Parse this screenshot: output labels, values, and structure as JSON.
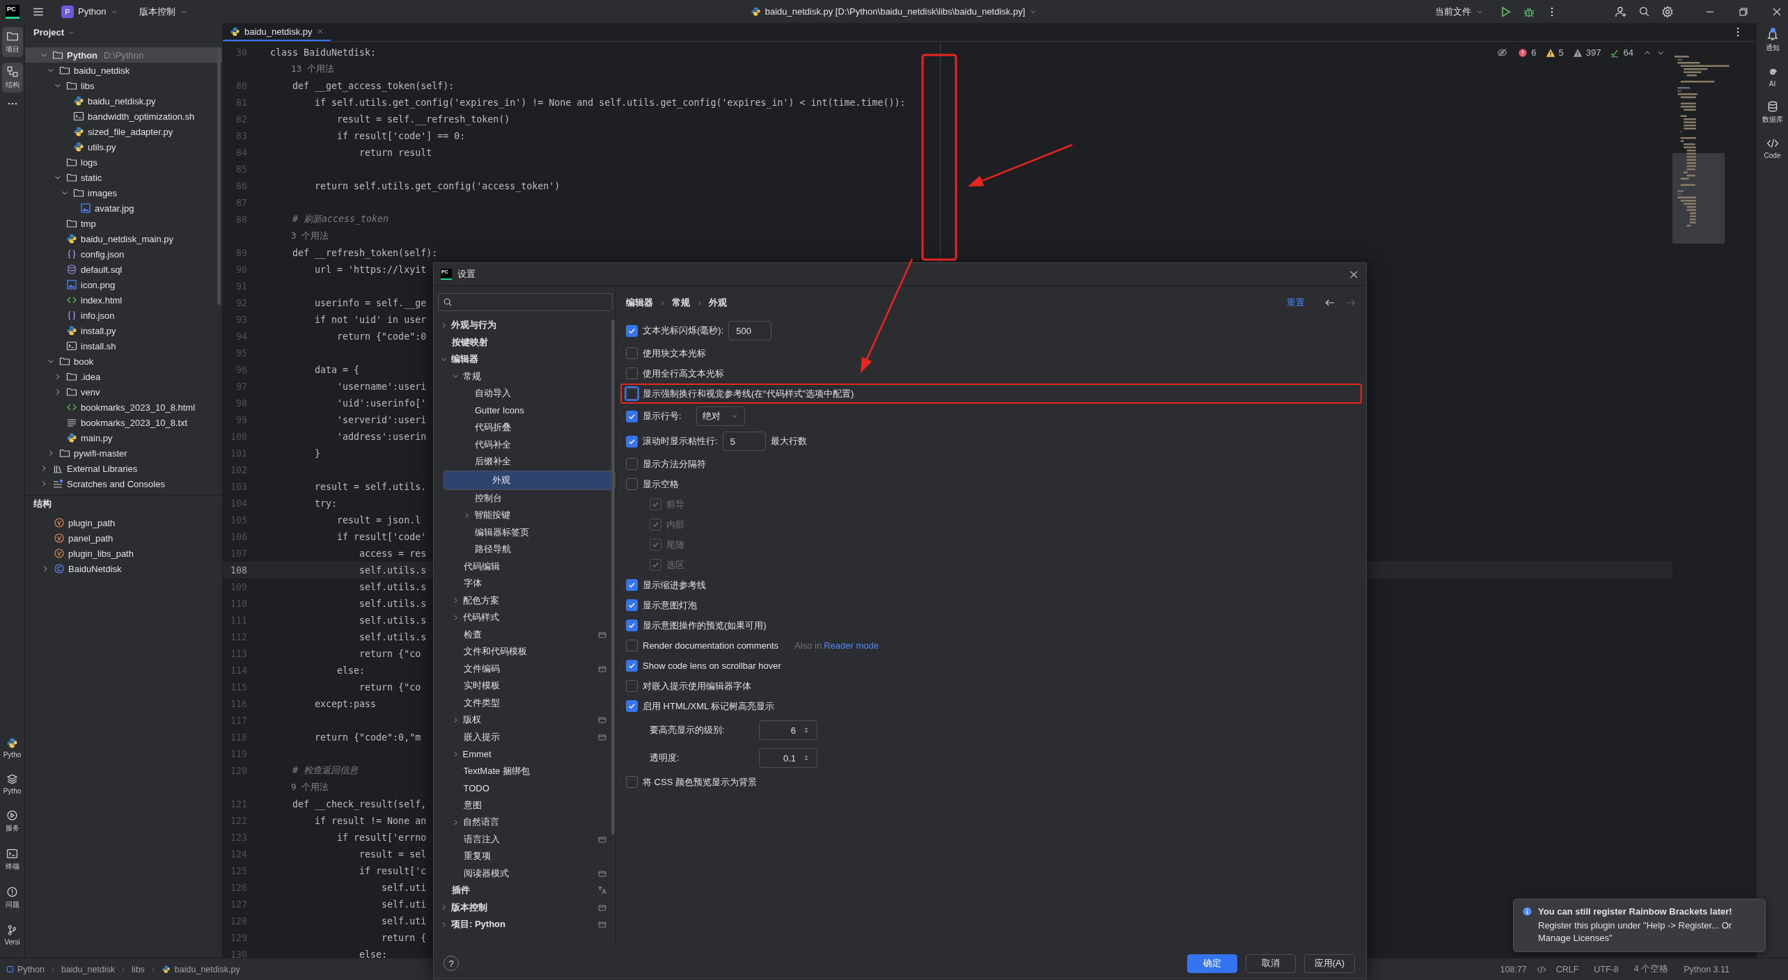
{
  "top_bar": {
    "logo": "PC",
    "project_badge": "P",
    "project": "Python",
    "vcs": "版本控制",
    "file_title": "baidu_netdisk.py [D:\\Python\\baidu_netdisk\\libs\\baidu_netdisk.py]",
    "run_config": "当前文件"
  },
  "left_toolbar": {
    "top": [
      {
        "kind": "folder",
        "label": "项目",
        "selected": true
      },
      {
        "kind": "structure",
        "label": "结构",
        "selected": true
      }
    ],
    "bottom": [
      {
        "kind": "python",
        "label": "Pytho"
      },
      {
        "kind": "layers",
        "label": "Pytho"
      },
      {
        "kind": "services",
        "label": "服务"
      },
      {
        "kind": "terminal",
        "label": "终端"
      },
      {
        "kind": "problems",
        "label": "问题"
      },
      {
        "kind": "git",
        "label": "Versi"
      }
    ]
  },
  "right_toolbar": [
    {
      "kind": "bell",
      "label": "通知",
      "badge": true
    },
    {
      "kind": "spiral",
      "label": "AI",
      "badge": false
    },
    {
      "kind": "database",
      "label": "数据库",
      "badge": false
    },
    {
      "kind": "code",
      "label": "Code",
      "badge": false
    }
  ],
  "project_panel": {
    "title": "Project",
    "tree": [
      {
        "name": "Python",
        "note": "D:\\Python",
        "kind": "folder",
        "expanded": true,
        "selected": true,
        "children": [
          {
            "name": "baidu_netdisk",
            "kind": "folder",
            "expanded": true,
            "selected": false,
            "children": [
              {
                "name": "libs",
                "kind": "folder",
                "expanded": true,
                "selected": false,
                "children": [
                  {
                    "name": "baidu_netdisk.py",
                    "kind": "python",
                    "selected": false
                  },
                  {
                    "name": "bandwidth_optimization.sh",
                    "kind": "shell",
                    "selected": false
                  },
                  {
                    "name": "sized_file_adapter.py",
                    "kind": "python",
                    "selected": false
                  },
                  {
                    "name": "utils.py",
                    "kind": "python",
                    "selected": false
                  }
                ]
              },
              {
                "name": "logs",
                "kind": "folder",
                "selected": false
              },
              {
                "name": "static",
                "kind": "folder",
                "expanded": true,
                "selected": false,
                "children": [
                  {
                    "name": "images",
                    "kind": "folder",
                    "expanded": true,
                    "selected": false,
                    "children": [
                      {
                        "name": "avatar.jpg",
                        "kind": "image",
                        "selected": false
                      }
                    ]
                  }
                ]
              },
              {
                "name": "tmp",
                "kind": "folder",
                "selected": false
              },
              {
                "name": "baidu_netdisk_main.py",
                "kind": "python",
                "selected": false
              },
              {
                "name": "config.json",
                "kind": "json",
                "selected": false
              },
              {
                "name": "default.sql",
                "kind": "sql",
                "selected": false
              },
              {
                "name": "icon.png",
                "kind": "image",
                "selected": false
              },
              {
                "name": "index.html",
                "kind": "html",
                "selected": false
              },
              {
                "name": "info.json",
                "kind": "json",
                "selected": false
              },
              {
                "name": "install.py",
                "kind": "python",
                "selected": false
              },
              {
                "name": "install.sh",
                "kind": "shell",
                "selected": false
              }
            ]
          },
          {
            "name": "book",
            "kind": "folder",
            "expanded": true,
            "selected": false,
            "children": [
              {
                "name": ".idea",
                "kind": "folder",
                "expanded": false,
                "selected": false
              },
              {
                "name": "venv",
                "kind": "folder",
                "expanded": false,
                "selected": false
              },
              {
                "name": "bookmarks_2023_10_8.html",
                "kind": "html",
                "selected": false
              },
              {
                "name": "bookmarks_2023_10_8.txt",
                "kind": "text",
                "selected": false
              },
              {
                "name": "main.py",
                "kind": "python",
                "selected": false
              }
            ]
          },
          {
            "name": "pywifi-master",
            "kind": "folder",
            "expanded": false,
            "selected": false
          }
        ]
      },
      {
        "name": "External Libraries",
        "kind": "library",
        "expanded": false,
        "selected": false
      },
      {
        "name": "Scratches and Consoles",
        "kind": "scratch",
        "expanded": false,
        "selected": false
      }
    ]
  },
  "structure_panel": {
    "title": "结构",
    "items": [
      {
        "name": "plugin_path",
        "kind": "variable"
      },
      {
        "name": "panel_path",
        "kind": "variable"
      },
      {
        "name": "plugin_libs_path",
        "kind": "variable"
      },
      {
        "name": "BaiduNetdisk",
        "kind": "class",
        "expanded": false
      }
    ]
  },
  "editor": {
    "tab": {
      "label": "baidu_netdisk.py",
      "selected": true
    },
    "inspections": {
      "errors": "6",
      "warnings": "5",
      "weak_warnings": "397",
      "typos": "64"
    },
    "right_margin_guide": true,
    "lines": [
      {
        "number": "30",
        "text": "class BaiduNetdisk:",
        "kind": "code",
        "current": false
      },
      {
        "text": "    13 个用法",
        "kind": "usages",
        "current": false
      },
      {
        "number": "80",
        "text": "    def __get_access_token(self):",
        "kind": "code",
        "current": false
      },
      {
        "number": "81",
        "text": "        if self.utils.get_config('expires_in') != None and self.utils.get_config('expires_in') < int(time.time()):",
        "kind": "code",
        "current": false
      },
      {
        "number": "82",
        "text": "            result = self.__refresh_token()",
        "kind": "code",
        "current": false
      },
      {
        "number": "83",
        "text": "            if result['code'] == 0:",
        "kind": "code",
        "current": false
      },
      {
        "number": "84",
        "text": "                return result",
        "kind": "code",
        "current": false
      },
      {
        "number": "85",
        "current": false
      },
      {
        "number": "86",
        "text": "        return self.utils.get_config('access_token')",
        "kind": "code",
        "current": false
      },
      {
        "number": "87",
        "current": false
      },
      {
        "number": "88",
        "text": "    # 刷新access_token",
        "kind": "comment",
        "current": false
      },
      {
        "text": "    3 个用法",
        "kind": "usages",
        "current": false
      },
      {
        "number": "89",
        "text": "    def __refresh_token(self):",
        "kind": "code",
        "current": false
      },
      {
        "number": "90",
        "text": "        url = 'https://lxyit",
        "kind": "code",
        "current": false
      },
      {
        "number": "91",
        "current": false
      },
      {
        "number": "92",
        "text": "        userinfo = self.__ge",
        "kind": "code",
        "current": false
      },
      {
        "number": "93",
        "text": "        if not 'uid' in user",
        "kind": "code",
        "current": false
      },
      {
        "number": "94",
        "text": "            return {\"code\":0",
        "kind": "code",
        "current": false
      },
      {
        "number": "95",
        "current": false
      },
      {
        "number": "96",
        "text": "        data = {",
        "kind": "code",
        "current": false
      },
      {
        "number": "97",
        "text": "            'username':useri",
        "kind": "code",
        "current": false
      },
      {
        "number": "98",
        "text": "            'uid':userinfo['",
        "kind": "code",
        "current": false
      },
      {
        "number": "99",
        "text": "            'serverid':useri",
        "kind": "code",
        "current": false
      },
      {
        "number": "100",
        "text": "            'address':userin",
        "kind": "code",
        "current": false
      },
      {
        "number": "101",
        "text": "        }",
        "kind": "code",
        "current": false
      },
      {
        "number": "102",
        "current": false
      },
      {
        "number": "103",
        "text": "        result = self.utils.",
        "kind": "code",
        "current": false
      },
      {
        "number": "104",
        "text": "        try:",
        "kind": "code",
        "current": false
      },
      {
        "number": "105",
        "text": "            result = json.l",
        "kind": "code",
        "current": false
      },
      {
        "number": "106",
        "text": "            if result['code'",
        "kind": "code",
        "current": false
      },
      {
        "number": "107",
        "text": "                access = res",
        "kind": "code",
        "current": false
      },
      {
        "number": "108",
        "text": "                self.utils.s",
        "kind": "code",
        "current": true
      },
      {
        "number": "109",
        "text": "                self.utils.s",
        "kind": "code",
        "current": false
      },
      {
        "number": "110",
        "text": "                self.utils.s",
        "kind": "code",
        "current": false
      },
      {
        "number": "111",
        "text": "                self.utils.s",
        "kind": "code",
        "current": false
      },
      {
        "number": "112",
        "text": "                self.utils.s",
        "kind": "code",
        "current": false
      },
      {
        "number": "113",
        "text": "                return {\"co",
        "kind": "code",
        "current": false
      },
      {
        "number": "114",
        "text": "            else:",
        "kind": "code",
        "current": false
      },
      {
        "number": "115",
        "text": "                return {\"co",
        "kind": "code",
        "current": false
      },
      {
        "number": "116",
        "text": "        except:pass",
        "kind": "code",
        "current": false
      },
      {
        "number": "117",
        "current": false
      },
      {
        "number": "118",
        "text": "        return {\"code\":0,\"m",
        "kind": "code",
        "current": false
      },
      {
        "number": "119",
        "current": false
      },
      {
        "number": "120",
        "text": "    # 检查返回信息",
        "kind": "comment",
        "current": false
      },
      {
        "text": "    9 个用法",
        "kind": "usages",
        "current": false
      },
      {
        "number": "121",
        "text": "    def __check_result(self,",
        "kind": "code",
        "current": false
      },
      {
        "number": "122",
        "text": "        if result != None an",
        "kind": "code",
        "current": false
      },
      {
        "number": "123",
        "text": "            if result['errno",
        "kind": "code",
        "current": false
      },
      {
        "number": "124",
        "text": "                result = sel",
        "kind": "code",
        "current": false
      },
      {
        "number": "125",
        "text": "                if result['c",
        "kind": "code",
        "current": false
      },
      {
        "number": "126",
        "text": "                    self.uti",
        "kind": "code",
        "current": false
      },
      {
        "number": "127",
        "text": "                    self.uti",
        "kind": "code",
        "current": false
      },
      {
        "number": "128",
        "text": "                    self.uti",
        "kind": "code",
        "current": false
      },
      {
        "number": "129",
        "text": "                    return {",
        "kind": "code",
        "current": false
      },
      {
        "number": "130",
        "text": "                else:",
        "kind": "code",
        "current": false
      }
    ]
  },
  "status_bar": {
    "breadcrumbs": [
      "Python",
      "baidu_netdisk",
      "libs",
      "baidu_netdisk.py"
    ],
    "position": "108:77",
    "line_separator": "CRLF",
    "encoding": "UTF-8",
    "indent": "4 个空格",
    "interpreter": "Python 3.11"
  },
  "settings_dialog": {
    "logo": "PC",
    "title": "设置",
    "tree": [
      {
        "label": "外观与行为",
        "expanded": false,
        "selected": false
      },
      {
        "label": "按键映射",
        "selected": false
      },
      {
        "label": "编辑器",
        "expanded": true,
        "selected": false,
        "children": [
          {
            "label": "常规",
            "expanded": true,
            "selected": false,
            "children": [
              {
                "label": "自动导入",
                "selected": false
              },
              {
                "label": "Gutter Icons",
                "selected": false
              },
              {
                "label": "代码折叠",
                "selected": false
              },
              {
                "label": "代码补全",
                "selected": false
              },
              {
                "label": "后缀补全",
                "selected": false
              },
              {
                "label": "外观",
                "selected": true
              },
              {
                "label": "控制台",
                "selected": false
              },
              {
                "label": "智能按键",
                "expanded": false,
                "selected": false
              },
              {
                "label": "编辑器标签页",
                "selected": false
              },
              {
                "label": "路径导航",
                "selected": false
              }
            ]
          },
          {
            "label": "代码编辑",
            "selected": false
          },
          {
            "label": "字体",
            "selected": false
          },
          {
            "label": "配色方案",
            "expanded": false,
            "selected": false
          },
          {
            "label": "代码样式",
            "expanded": false,
            "selected": false
          },
          {
            "label": "检查",
            "selected": false,
            "project_scope": true
          },
          {
            "label": "文件和代码模板",
            "selected": false
          },
          {
            "label": "文件编码",
            "selected": false,
            "project_scope": true
          },
          {
            "label": "实时模板",
            "selected": false
          },
          {
            "label": "文件类型",
            "selected": false
          },
          {
            "label": "版权",
            "expanded": false,
            "selected": false,
            "project_scope": true
          },
          {
            "label": "嵌入提示",
            "selected": false,
            "project_scope": true
          },
          {
            "label": "Emmet",
            "expanded": false,
            "selected": false
          },
          {
            "label": "TextMate 捆绑包",
            "selected": false
          },
          {
            "label": "TODO",
            "selected": false
          },
          {
            "label": "意图",
            "selected": false
          },
          {
            "label": "自然语言",
            "expanded": false,
            "selected": false
          },
          {
            "label": "语言注入",
            "selected": false,
            "project_scope": true
          },
          {
            "label": "重复项",
            "selected": false
          },
          {
            "label": "阅读器模式",
            "selected": false,
            "project_scope": true
          }
        ]
      },
      {
        "label": "插件",
        "selected": false,
        "translatable": true
      },
      {
        "label": "版本控制",
        "expanded": false,
        "selected": false,
        "project_scope": true
      },
      {
        "label": "项目: Python",
        "expanded": false,
        "selected": false,
        "project_scope": true
      }
    ],
    "breadcrumbs": [
      "编辑器",
      "常规",
      "外观"
    ],
    "reset": "重置",
    "back_enabled": true,
    "forward_enabled": false,
    "options": [
      {
        "kind": "checkbox",
        "label": "文本光标闪烁(毫秒):",
        "checked": true,
        "value": "500",
        "focused": false,
        "annotated": false
      },
      {
        "kind": "checkbox",
        "label": "使用块文本光标",
        "checked": false,
        "focused": false,
        "annotated": false
      },
      {
        "kind": "checkbox",
        "label": "使用全行高文本光标",
        "checked": false,
        "focused": false,
        "annotated": false
      },
      {
        "kind": "checkbox",
        "label": "显示强制换行和视觉参考线(在“代码样式”选项中配置)",
        "checked": false,
        "focused": true,
        "annotated": true
      },
      {
        "kind": "select",
        "label": "显示行号:",
        "checked": true,
        "value": "绝对",
        "focused": false,
        "annotated": false
      },
      {
        "kind": "checkbox",
        "label": "滚动时显示粘性行:",
        "checked": true,
        "value": "5",
        "suffix": "最大行数",
        "focused": false,
        "annotated": false
      },
      {
        "kind": "checkbox",
        "label": "显示方法分隔符",
        "checked": false,
        "focused": false,
        "annotated": false
      },
      {
        "kind": "checkbox",
        "label": "显示空格",
        "checked": false,
        "focused": false,
        "annotated": false,
        "children": [
          {
            "kind": "checkbox",
            "label": "前导",
            "checked": true,
            "disabled": true
          },
          {
            "kind": "checkbox",
            "label": "内部",
            "checked": true,
            "disabled": true
          },
          {
            "kind": "checkbox",
            "label": "尾随",
            "checked": true,
            "disabled": true
          },
          {
            "kind": "checkbox",
            "label": "选区",
            "checked": true,
            "disabled": true
          }
        ]
      },
      {
        "kind": "checkbox",
        "label": "显示缩进参考线",
        "checked": true,
        "focused": false,
        "annotated": false
      },
      {
        "kind": "checkbox",
        "label": "显示意图灯泡",
        "checked": true,
        "focused": false,
        "annotated": false
      },
      {
        "kind": "checkbox",
        "label": "显示意图操作的预览(如果可用)",
        "checked": true,
        "focused": false,
        "annotated": false
      },
      {
        "kind": "checkbox",
        "label": "Render documentation comments",
        "checked": false,
        "note": "Also in",
        "link": "Reader mode",
        "focused": false,
        "annotated": false
      },
      {
        "kind": "checkbox",
        "label": "Show code lens on scrollbar hover",
        "checked": true,
        "focused": false,
        "annotated": false
      },
      {
        "kind": "checkbox",
        "label": "对嵌入提示使用编辑器字体",
        "checked": false,
        "focused": false,
        "annotated": false
      },
      {
        "kind": "checkbox",
        "label": "启用 HTML/XML 标记树高亮显示",
        "checked": true,
        "focused": false,
        "annotated": false,
        "children": [
          {
            "kind": "spinner",
            "label": "要高亮显示的级别:",
            "value": "6"
          },
          {
            "kind": "spinner",
            "label": "透明度:",
            "value": "0.1"
          }
        ]
      },
      {
        "kind": "checkbox",
        "label": "将 CSS 颜色预览显示为背景",
        "checked": false,
        "focused": false,
        "annotated": false
      }
    ],
    "help": "?",
    "buttons": [
      {
        "label": "确定",
        "kind": "primary"
      },
      {
        "label": "取消",
        "kind": "default"
      },
      {
        "label": "应用(A)",
        "kind": "default"
      }
    ]
  },
  "notification": {
    "title": "You can still register Rainbow Brackets later!",
    "body": "Register this plugin under \"Help -> Register... Or Manage Licenses\""
  },
  "annotations": [
    {
      "kind": "frame"
    },
    {
      "kind": "arrow"
    },
    {
      "kind": "arrow"
    }
  ]
}
